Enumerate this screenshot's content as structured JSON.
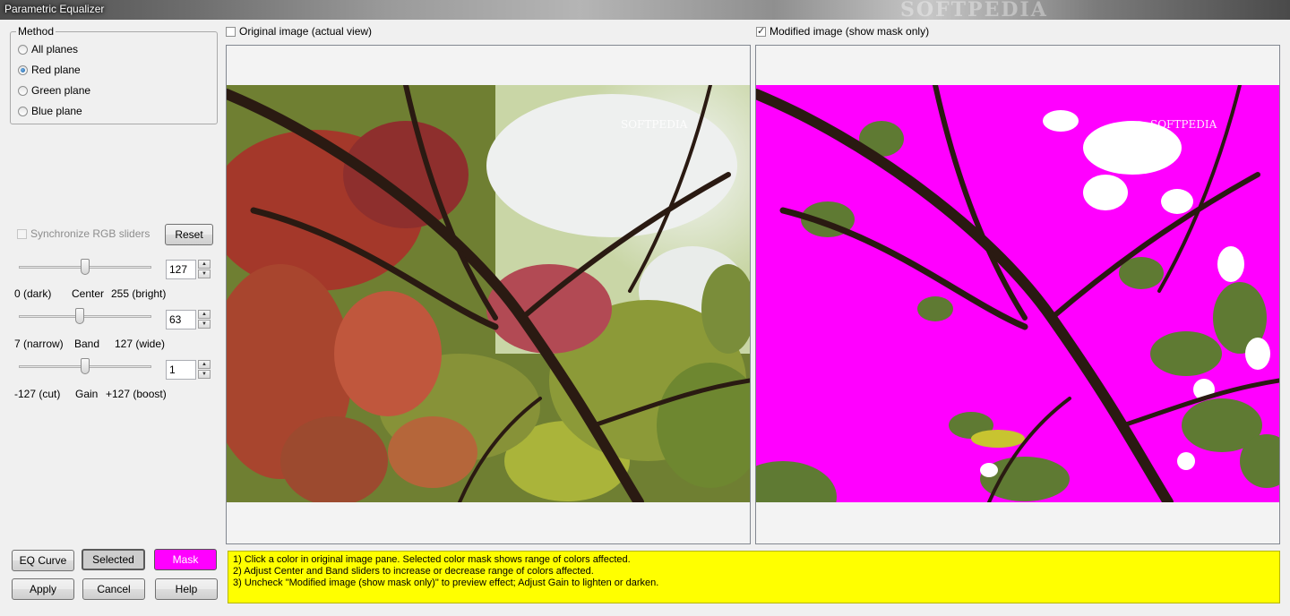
{
  "window": {
    "title": "Parametric Equalizer",
    "watermark": "SOFTPEDIA"
  },
  "method": {
    "legend": "Method",
    "options": [
      "All planes",
      "Red plane",
      "Green plane",
      "Blue plane"
    ],
    "selected": "Red plane"
  },
  "controls": {
    "sync_label": "Synchronize RGB sliders",
    "sync_checked": false,
    "reset_label": "Reset",
    "center": {
      "value": "127",
      "min_label": "0 (dark)",
      "name": "Center",
      "max_label": "255 (bright)",
      "fraction": 0.5
    },
    "band": {
      "value": "63",
      "min_label": "7 (narrow)",
      "name": "Band",
      "max_label": "127 (wide)",
      "fraction": 0.46
    },
    "gain": {
      "value": "1",
      "min_label": "-127 (cut)",
      "name": "Gain",
      "max_label": "+127 (boost)",
      "fraction": 0.5
    }
  },
  "panes": {
    "original_label": "Original image (actual view)",
    "original_checked": false,
    "modified_label": "Modified image (show mask only)",
    "modified_checked": true,
    "image_watermark": "SOFTPEDIA"
  },
  "buttons": {
    "eq_curve": "EQ Curve",
    "selected": "Selected",
    "mask": "Mask",
    "apply": "Apply",
    "cancel": "Cancel",
    "help": "Help"
  },
  "info": {
    "lines": [
      "1) Click a color in original image pane. Selected color mask shows range of colors affected.",
      "2) Adjust Center and Band sliders to increase or decrease range of colors affected.",
      "3) Uncheck \"Modified image (show mask only)\" to preview effect; Adjust Gain to lighten or darken."
    ]
  },
  "colors": {
    "mask": "#ff00ff",
    "info_bg": "#ffff00"
  }
}
